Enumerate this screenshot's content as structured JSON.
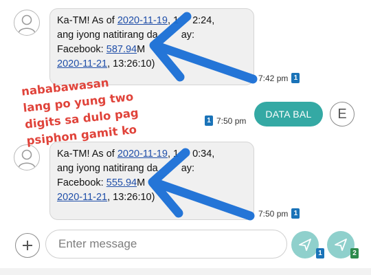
{
  "messages": [
    {
      "lines": [
        "Ka-TM! As of ",
        ", 1",
        "2:24,",
        "ang iyong natitirang da",
        "ay:",
        "Facebook: ",
        "M",
        ", 13:26:10)"
      ],
      "date_link": "2020-11-19",
      "amount_link": "587.94",
      "expiry_link": "2020-11-21",
      "time": "7:42 pm",
      "sim": "1"
    },
    {
      "lines": [
        "Ka-TM! As of ",
        ", 1",
        "0:34,",
        "ang iyong natitirang da",
        "ay:",
        "Facebook: ",
        "M",
        ", 13:26:10)"
      ],
      "date_link": "2020-11-19",
      "amount_link": "555.94",
      "expiry_link": "2020-11-21",
      "time": "7:50 pm",
      "sim": "1"
    }
  ],
  "outgoing": {
    "text": "DATA BAL",
    "time": "7:50 pm",
    "sim": "1",
    "contact_initial": "E"
  },
  "annotation": {
    "lines": [
      "nababawasan",
      "lang po yung two",
      "digits sa dulo pag",
      "psiphon gamit ko"
    ],
    "color": "#e0433a"
  },
  "arrow_color": "#1a6fd6",
  "compose": {
    "placeholder": "Enter message",
    "add_icon": "plus-icon",
    "send_sim1": "1",
    "send_sim2": "2"
  },
  "colors": {
    "outgoing_bubble": "#34a9a4",
    "send_button": "#8fd0cc",
    "sim1": "#1a73b8",
    "sim2": "#2e8b4c",
    "link": "#1f4ea8"
  }
}
